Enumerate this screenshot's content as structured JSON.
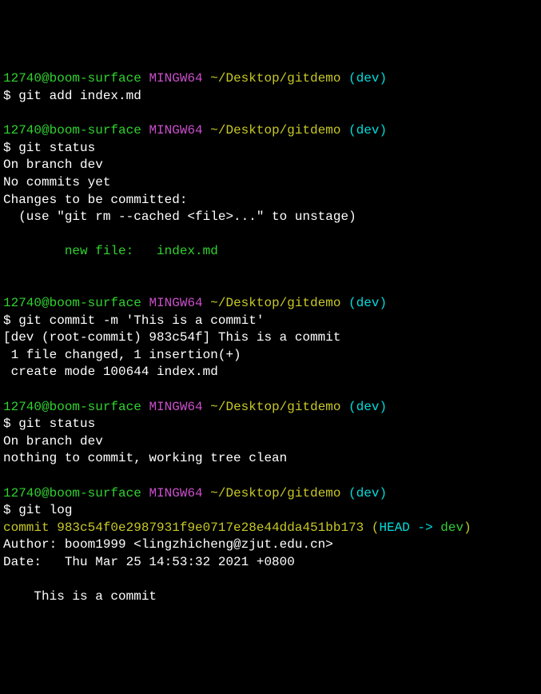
{
  "blocks": [
    {
      "prompt": {
        "user_host": "12740@boom-surface",
        "shell": "MINGW64",
        "path": "~/Desktop/gitdemo",
        "branch": "(dev)"
      },
      "commands": [
        "$ git add index.md"
      ],
      "output": []
    },
    {
      "prompt": {
        "user_host": "12740@boom-surface",
        "shell": "MINGW64",
        "path": "~/Desktop/gitdemo",
        "branch": "(dev)"
      },
      "commands": [
        "$ git status"
      ],
      "output": [
        "On branch dev",
        "",
        "No commits yet",
        "",
        "Changes to be committed:",
        "  (use \"git rm --cached <file>...\" to unstage)"
      ],
      "staged": "        new file:   index.md"
    },
    {
      "prompt": {
        "user_host": "12740@boom-surface",
        "shell": "MINGW64",
        "path": "~/Desktop/gitdemo",
        "branch": "(dev)"
      },
      "commands": [
        "$ git commit -m 'This is a commit'"
      ],
      "output": [
        "[dev (root-commit) 983c54f] This is a commit",
        " 1 file changed, 1 insertion(+)",
        " create mode 100644 index.md"
      ]
    },
    {
      "prompt": {
        "user_host": "12740@boom-surface",
        "shell": "MINGW64",
        "path": "~/Desktop/gitdemo",
        "branch": "(dev)"
      },
      "commands": [
        "$ git status"
      ],
      "output": [
        "On branch dev",
        "nothing to commit, working tree clean"
      ]
    },
    {
      "prompt": {
        "user_host": "12740@boom-surface",
        "shell": "MINGW64",
        "path": "~/Desktop/gitdemo",
        "branch": "(dev)"
      },
      "commands": [
        "$ git log"
      ],
      "log": {
        "commit_prefix": "commit ",
        "commit_hash": "983c54f0e2987931f9e0717e28e44dda451bb173",
        "ref_open": " (",
        "ref_head": "HEAD -> ",
        "ref_branch": "dev",
        "ref_close": ")",
        "author": "Author: boom1999 <lingzhicheng@zjut.edu.cn>",
        "date": "Date:   Thu Mar 25 14:53:32 2021 +0800",
        "message": "    This is a commit"
      }
    }
  ]
}
